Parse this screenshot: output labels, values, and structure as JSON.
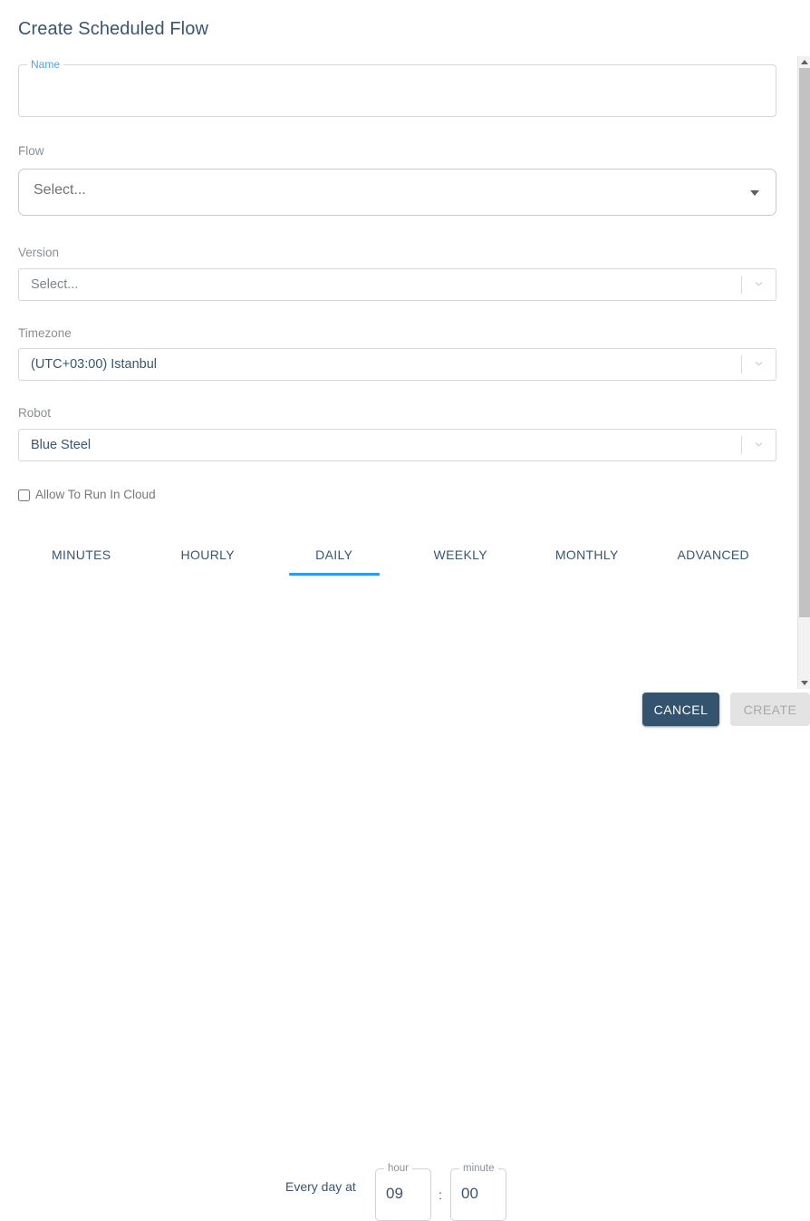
{
  "dialog": {
    "title": "Create Scheduled Flow"
  },
  "form": {
    "name": {
      "label": "Name",
      "value": "",
      "placeholder": ""
    },
    "flow": {
      "label": "Flow",
      "placeholder": "Select...",
      "caret_icon": "caret-down-icon"
    },
    "version": {
      "label": "Version",
      "placeholder": "Select...",
      "chevron_icon": "chevron-down-icon"
    },
    "timezone": {
      "label": "Timezone",
      "value": "(UTC+03:00) Istanbul",
      "chevron_icon": "chevron-down-icon"
    },
    "robot": {
      "label": "Robot",
      "value": "Blue Steel",
      "chevron_icon": "chevron-down-icon"
    },
    "allow_cloud": {
      "label": "Allow To Run In Cloud",
      "checked": false
    }
  },
  "schedule": {
    "tabs": [
      {
        "label": "MINUTES",
        "active": false
      },
      {
        "label": "HOURLY",
        "active": false
      },
      {
        "label": "DAILY",
        "active": true
      },
      {
        "label": "WEEKLY",
        "active": false
      },
      {
        "label": "MONTHLY",
        "active": false
      },
      {
        "label": "ADVANCED",
        "active": false
      }
    ],
    "daily": {
      "prefix_label": "Every day at",
      "hour_label": "hour",
      "hour_value": "09",
      "separator": ":",
      "minute_label": "minute",
      "minute_value": "00"
    }
  },
  "footer": {
    "cancel_label": "CANCEL",
    "create_label": "CREATE",
    "create_disabled": true
  },
  "scrollbar": {
    "up_icon": "scroll-up-arrow-icon",
    "down_icon": "scroll-down-arrow-icon",
    "thumb": "scrollbar-thumb"
  },
  "colors": {
    "accent_blue": "#2a9bf0",
    "label_blue": "#4aa3ef",
    "text_slate": "#3a5570",
    "muted_gray": "#8a8f94",
    "cancel_bg": "#34536f",
    "create_disabled_bg": "#e3e3e3"
  }
}
